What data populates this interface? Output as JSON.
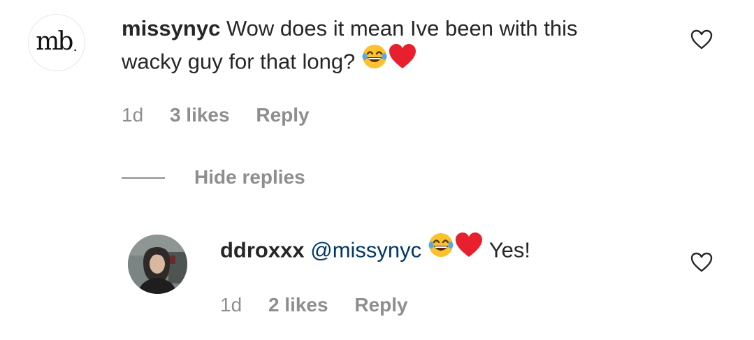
{
  "comments": [
    {
      "username": "missynyc",
      "text_line1": "Wow does it mean Ive been with this",
      "text_line2": "wacky guy for that long?",
      "emojis": [
        "face-with-tears-of-joy-icon",
        "red-heart-icon"
      ],
      "time": "1d",
      "likes": "3 likes",
      "reply_label": "Reply",
      "avatar": {
        "logo_text": "mb",
        "logo_dot": "."
      }
    }
  ],
  "hide_replies_label": "Hide replies",
  "replies": [
    {
      "username": "ddroxxx",
      "mention": "@missynyc",
      "emojis": [
        "face-with-tears-of-joy-icon",
        "red-heart-icon"
      ],
      "text": "Yes!",
      "time": "1d",
      "likes": "2 likes",
      "reply_label": "Reply"
    }
  ],
  "colors": {
    "text": "#262626",
    "secondary": "#8e8e8e",
    "mention": "#00376b",
    "heart_emoji": "#e8202e",
    "joy_emoji": "#f9c22e"
  }
}
